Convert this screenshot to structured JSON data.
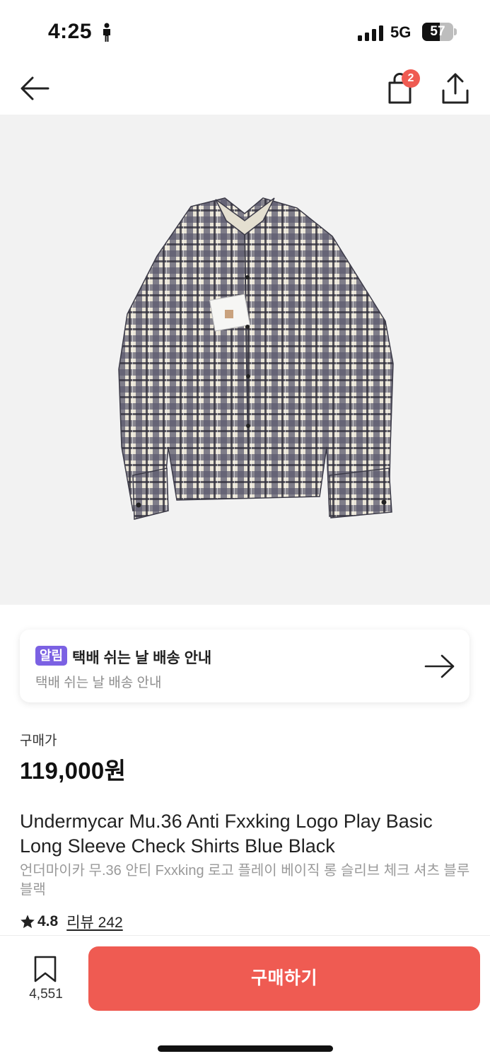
{
  "status_bar": {
    "time": "4:25",
    "network": "5G",
    "battery_level": "57",
    "battery_fraction": 0.57
  },
  "nav": {
    "back_icon": "arrow-left-icon",
    "cart_icon": "shopping-bag-icon",
    "cart_badge": "2",
    "share_icon": "share-icon"
  },
  "product_image": {
    "icon": "plaid-shirt-photo",
    "background": "#f2f2f2"
  },
  "notice": {
    "badge": "알림",
    "title": "택배 쉬는 날 배송 안내",
    "subtitle": "택배 쉬는 날 배송 안내",
    "badge_color": "#7b61e3"
  },
  "price": {
    "label": "구매가",
    "value": "119,000원"
  },
  "product": {
    "title": "Undermycar Mu.36 Anti Fxxking Logo Play Basic Long Sleeve Check Shirts Blue Black",
    "subtitle": "언더마이카 무.36 안티 Fxxking 로고 플레이 베이직 롱 슬리브 체크 셔츠 블루 블랙"
  },
  "rating": {
    "score": "4.8",
    "review_link": "리뷰 242"
  },
  "bottom_bar": {
    "wish_count": "4,551",
    "buy_label": "구매하기",
    "accent_color": "#ef5b52"
  }
}
